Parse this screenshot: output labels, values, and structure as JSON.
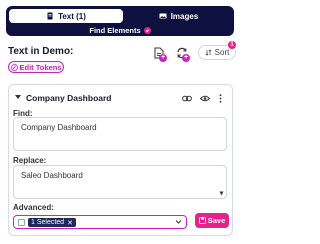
{
  "tabs": {
    "text_label": "Text (1)",
    "images_label": "Images",
    "find_label": "Find Elements"
  },
  "toolbar": {
    "heading": "Text in Demo:",
    "sort_label": "Sort",
    "sort_badge": "1",
    "edit_tokens_label": "Edit Tokens"
  },
  "card": {
    "title": "Company Dashboard",
    "find_label": "Find:",
    "find_value": "Company Dashboard",
    "replace_label": "Replace:",
    "replace_value": "Saleo Dashboard",
    "advanced_label": "Advanced:",
    "selected_chip": "1 Selected",
    "save_label": "Save"
  },
  "colors": {
    "navy": "#0e1140",
    "pink": "#e8208a",
    "magenta": "#c028b8"
  }
}
